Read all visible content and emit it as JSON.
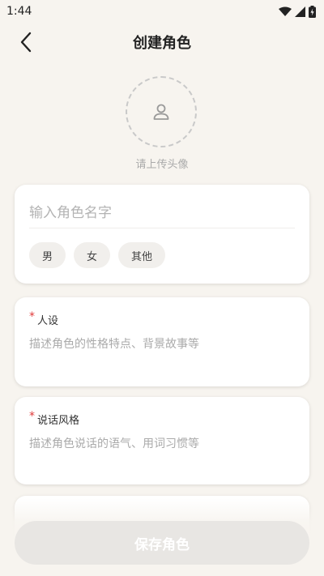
{
  "status_bar": {
    "time": "1:44"
  },
  "header": {
    "title": "创建角色"
  },
  "avatar": {
    "hint": "请上传头像"
  },
  "name_field": {
    "placeholder": "输入角色名字",
    "value": ""
  },
  "gender": {
    "options": [
      "男",
      "女",
      "其他"
    ]
  },
  "persona": {
    "required": "*",
    "label": "人设",
    "placeholder": "描述角色的性格特点、背景故事等"
  },
  "speaking_style": {
    "required": "*",
    "label": "说话风格",
    "placeholder": "描述角色说话的语气、用词习惯等"
  },
  "save": {
    "label": "保存角色"
  },
  "colors": {
    "background": "#f7f4ef",
    "required": "#e03b3b",
    "save_button_disabled": "#e8e6e3"
  }
}
